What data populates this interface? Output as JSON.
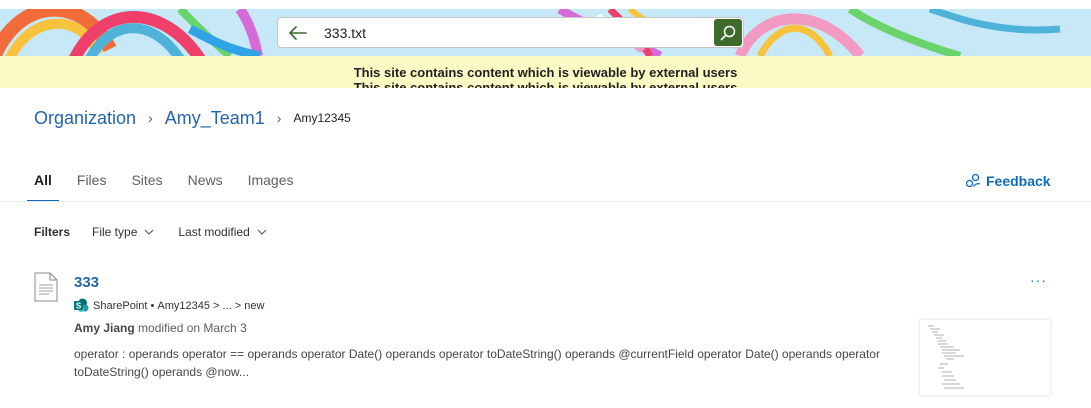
{
  "search": {
    "value": "333.txt"
  },
  "notice": {
    "line1": "This site contains content which is viewable by external users",
    "line2": "This site contains content which is viewable by external users"
  },
  "breadcrumb": {
    "items": [
      "Organization",
      "Amy_Team1"
    ],
    "current": "Amy12345"
  },
  "tabs": [
    "All",
    "Files",
    "Sites",
    "News",
    "Images"
  ],
  "active_tab": "All",
  "feedback_label": "Feedback",
  "filters": {
    "label": "Filters",
    "file_type": "File type",
    "last_modified": "Last modified"
  },
  "result": {
    "title": "333",
    "source": "SharePoint",
    "path_sep": " • ",
    "site": "Amy12345",
    "path_mid": " > ... > ",
    "folder": "new",
    "author": "Amy Jiang",
    "modified": " modified on March 3",
    "snippet": "operator : operands operator == operands operator Date() operands operator toDateString() operands @currentField operator Date() operands operator toDateString() operands @now...",
    "more": "···"
  },
  "colors": {
    "accent": "#0f6cbd",
    "link": "#2565ae",
    "search_button": "#3e6b2c",
    "notice_bg": "#fbfbc5",
    "banner_bg": "#c7e8f7"
  },
  "icons": {
    "back": "arrow-left-icon",
    "search": "search-icon",
    "feedback": "feedback-icon",
    "chevron": "chevron-down-icon",
    "file": "document-icon",
    "sharepoint": "sharepoint-icon"
  }
}
